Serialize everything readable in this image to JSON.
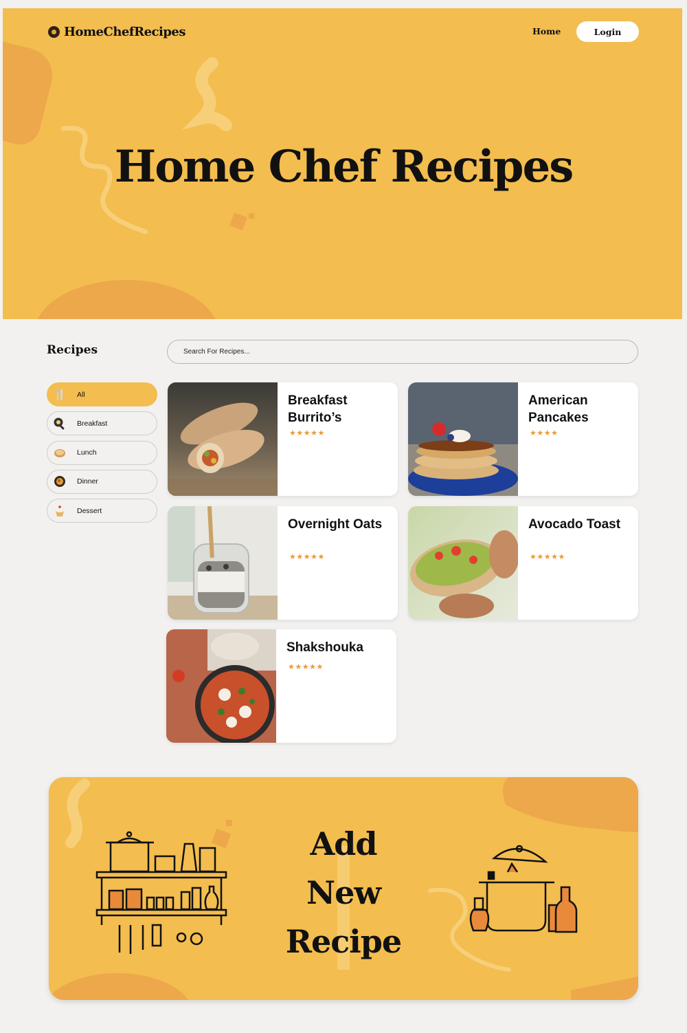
{
  "header": {
    "logo_text": "HomeChefRecipes",
    "nav_home": "Home",
    "nav_login": "Login",
    "hero_title": "Home Chef Recipes"
  },
  "recipes": {
    "section_title": "Recipes",
    "search_placeholder": "Search For Recipes...",
    "categories": [
      {
        "label": "All",
        "icon": "utensils-icon",
        "active": true
      },
      {
        "label": "Breakfast",
        "icon": "frying-pan-icon",
        "active": false
      },
      {
        "label": "Lunch",
        "icon": "bread-icon",
        "active": false
      },
      {
        "label": "Dinner",
        "icon": "dinner-plate-icon",
        "active": false
      },
      {
        "label": "Dessert",
        "icon": "cupcake-icon",
        "active": false
      }
    ],
    "cards": [
      {
        "title": "Breakfast Burrito’s",
        "rating": 5,
        "stars": "★★★★★"
      },
      {
        "title": "American Pancakes",
        "rating": 4,
        "stars": "★★★★"
      },
      {
        "title": "Overnight Oats",
        "rating": 5,
        "stars": "★★★★★"
      },
      {
        "title": "Avocado Toast",
        "rating": 5,
        "stars": "★★★★★"
      },
      {
        "title": "Shakshouka",
        "rating": 5,
        "stars": "★★★★★"
      }
    ]
  },
  "banner": {
    "title": "Add New Recipe",
    "left_icon": "kitchen-shelf-icon",
    "right_icon": "cooking-pot-icon"
  },
  "colors": {
    "accent": "#f3bd4f",
    "accent_dark": "#eca84a",
    "star": "#e89a3a",
    "background": "#f2f1ef"
  }
}
